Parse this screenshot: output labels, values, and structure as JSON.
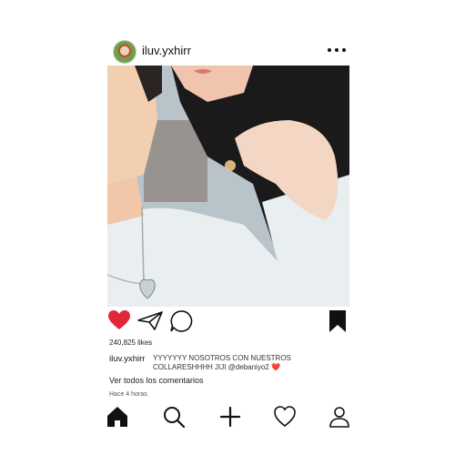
{
  "post": {
    "username": "iluv.yxhirr",
    "likes": "240,825 likes",
    "caption_user": "iluv.yxhirr",
    "caption_text": "YYYYYYY NOSOTROS CON NUESTROS COLLARESHHHH JIJI @debaniyo2",
    "caption_emoji": "❤️",
    "view_comments": "Ver todos los comentarios",
    "time_ago": "Hace 4 horas."
  },
  "icons": {
    "more": "more-options-icon",
    "like": "heart-filled-icon",
    "share": "paper-plane-icon",
    "comment": "comment-bubble-icon",
    "save": "bookmark-icon",
    "home": "home-icon",
    "search": "search-icon",
    "add": "plus-icon",
    "activity": "heart-outline-icon",
    "profile": "profile-icon"
  },
  "colors": {
    "like": "#e0283a",
    "text": "#111111",
    "photo_shirt": "#e9eef0",
    "photo_hair": "#1a1a1a"
  }
}
